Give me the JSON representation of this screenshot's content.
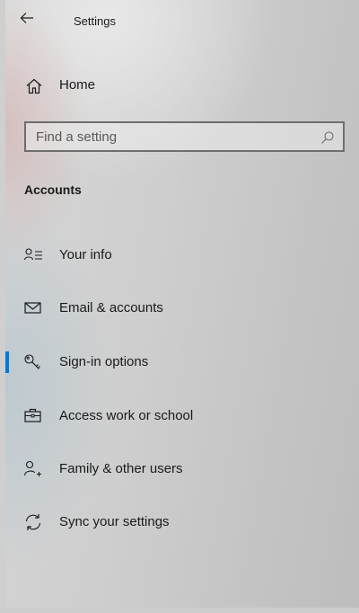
{
  "window": {
    "title": "Settings"
  },
  "home": {
    "label": "Home"
  },
  "search": {
    "placeholder": "Find a setting"
  },
  "section": {
    "title": "Accounts"
  },
  "nav": {
    "items": [
      {
        "label": "Your info",
        "icon": "person-card-icon"
      },
      {
        "label": "Email & accounts",
        "icon": "envelope-icon"
      },
      {
        "label": "Sign-in options",
        "icon": "key-icon",
        "selected": true
      },
      {
        "label": "Access work or school",
        "icon": "briefcase-icon"
      },
      {
        "label": "Family & other users",
        "icon": "person-add-icon"
      },
      {
        "label": "Sync your settings",
        "icon": "sync-icon"
      }
    ]
  },
  "colors": {
    "accent": "#0078d7",
    "text": "#1a1a1a",
    "search_border": "#6e6e6e"
  }
}
